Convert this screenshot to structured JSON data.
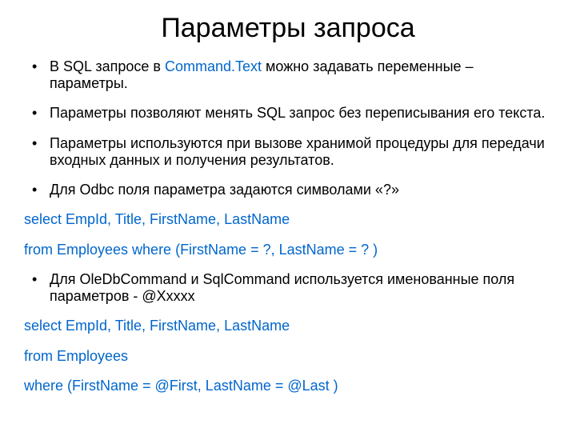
{
  "title": "Параметры запроса",
  "bullets": {
    "b1_pre": "В SQL запросе в  ",
    "b1_accent": "Command.Text",
    "b1_post": " можно задавать переменные – параметры.",
    "b2": "Параметры позволяют менять SQL запрос без переписывания его текста.",
    "b3": "Параметры используются при вызове хранимой процедуры для передачи входных данных и получения результатов.",
    "b4": "Для Odbc поля параметра задаются символами «?»",
    "c1": "select EmpId, Title, FirstName, LastName",
    "c2": "from Employees where (FirstName = ?, LastName = ? )",
    "b5": "Для OleDbCommand и SqlCommand используется именованные поля параметров - @Xxxxx",
    "c3": "select EmpId, Title, FirstName, LastName",
    "c4": "from Employees",
    "c5": "where (FirstName = @First, LastName = @Last )"
  }
}
